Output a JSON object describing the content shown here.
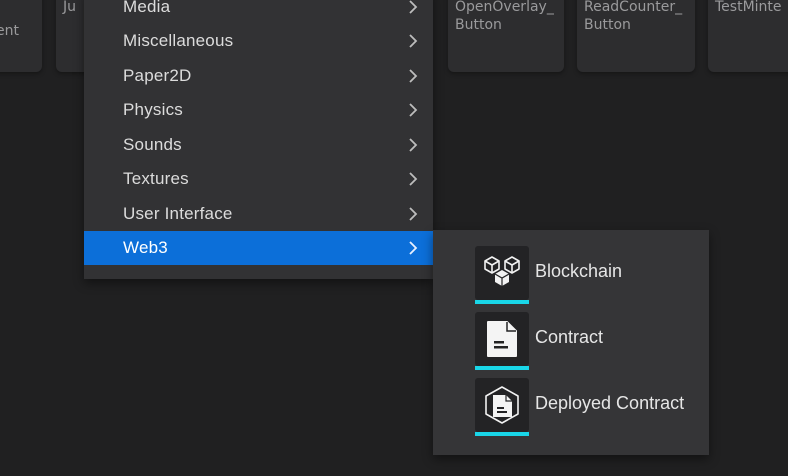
{
  "background_tiles": [
    {
      "label": "\nent"
    },
    {
      "label": "Ju"
    },
    {
      "label": "OpenOverlay_\nButton"
    },
    {
      "label": "ReadCounter_\nButton"
    },
    {
      "label": "TestMinte"
    }
  ],
  "menu": {
    "items": [
      {
        "label": "Media"
      },
      {
        "label": "Miscellaneous"
      },
      {
        "label": "Paper2D"
      },
      {
        "label": "Physics"
      },
      {
        "label": "Sounds"
      },
      {
        "label": "Textures"
      },
      {
        "label": "User Interface"
      },
      {
        "label": "Web3"
      }
    ],
    "active_label": "Web3"
  },
  "submenu": {
    "items": [
      {
        "label": "Blockchain",
        "icon": "blockchain-cubes-icon"
      },
      {
        "label": "Contract",
        "icon": "document-icon"
      },
      {
        "label": "Deployed Contract",
        "icon": "deployed-contract-icon"
      }
    ]
  },
  "colors": {
    "active_highlight": "#0c6fd9",
    "asset_underline": "#19d6e8",
    "menu_bg": "#323234",
    "app_bg": "#202021"
  }
}
